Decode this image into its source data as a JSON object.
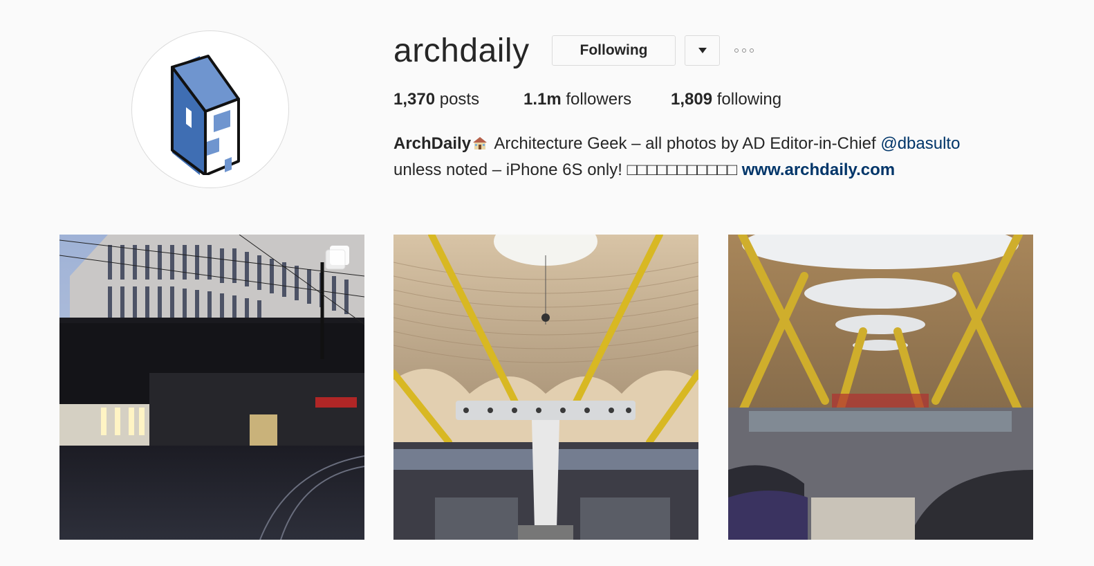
{
  "profile": {
    "username": "archdaily",
    "avatar_icon": "archdaily-building-logo",
    "following_label": "Following",
    "dropdown_icon": "caret-down-icon",
    "more_icon": "more-options-icon"
  },
  "stats": {
    "posts_count": "1,370",
    "posts_label": "posts",
    "followers_count": "1.1m",
    "followers_label": "followers",
    "following_count": "1,809",
    "following_label": "following"
  },
  "bio": {
    "name": "ArchDaily",
    "house_icon": "house-emoji-icon",
    "text1": " Architecture Geek – all photos by AD Editor-in-Chief ",
    "mention": "@dbasulto",
    "text2": "unless noted – iPhone 6S only! □□□□□□□□□□□ ",
    "link": "www.archdaily.com"
  },
  "posts": [
    {
      "type": "carousel",
      "icon": "multiple-photos-icon"
    },
    {
      "type": "photo"
    },
    {
      "type": "photo"
    }
  ],
  "colors": {
    "background": "#fafafa",
    "text": "#262626",
    "link": "#003569",
    "border": "#dbdbdb",
    "logo_blue": "#3f6eb3"
  }
}
